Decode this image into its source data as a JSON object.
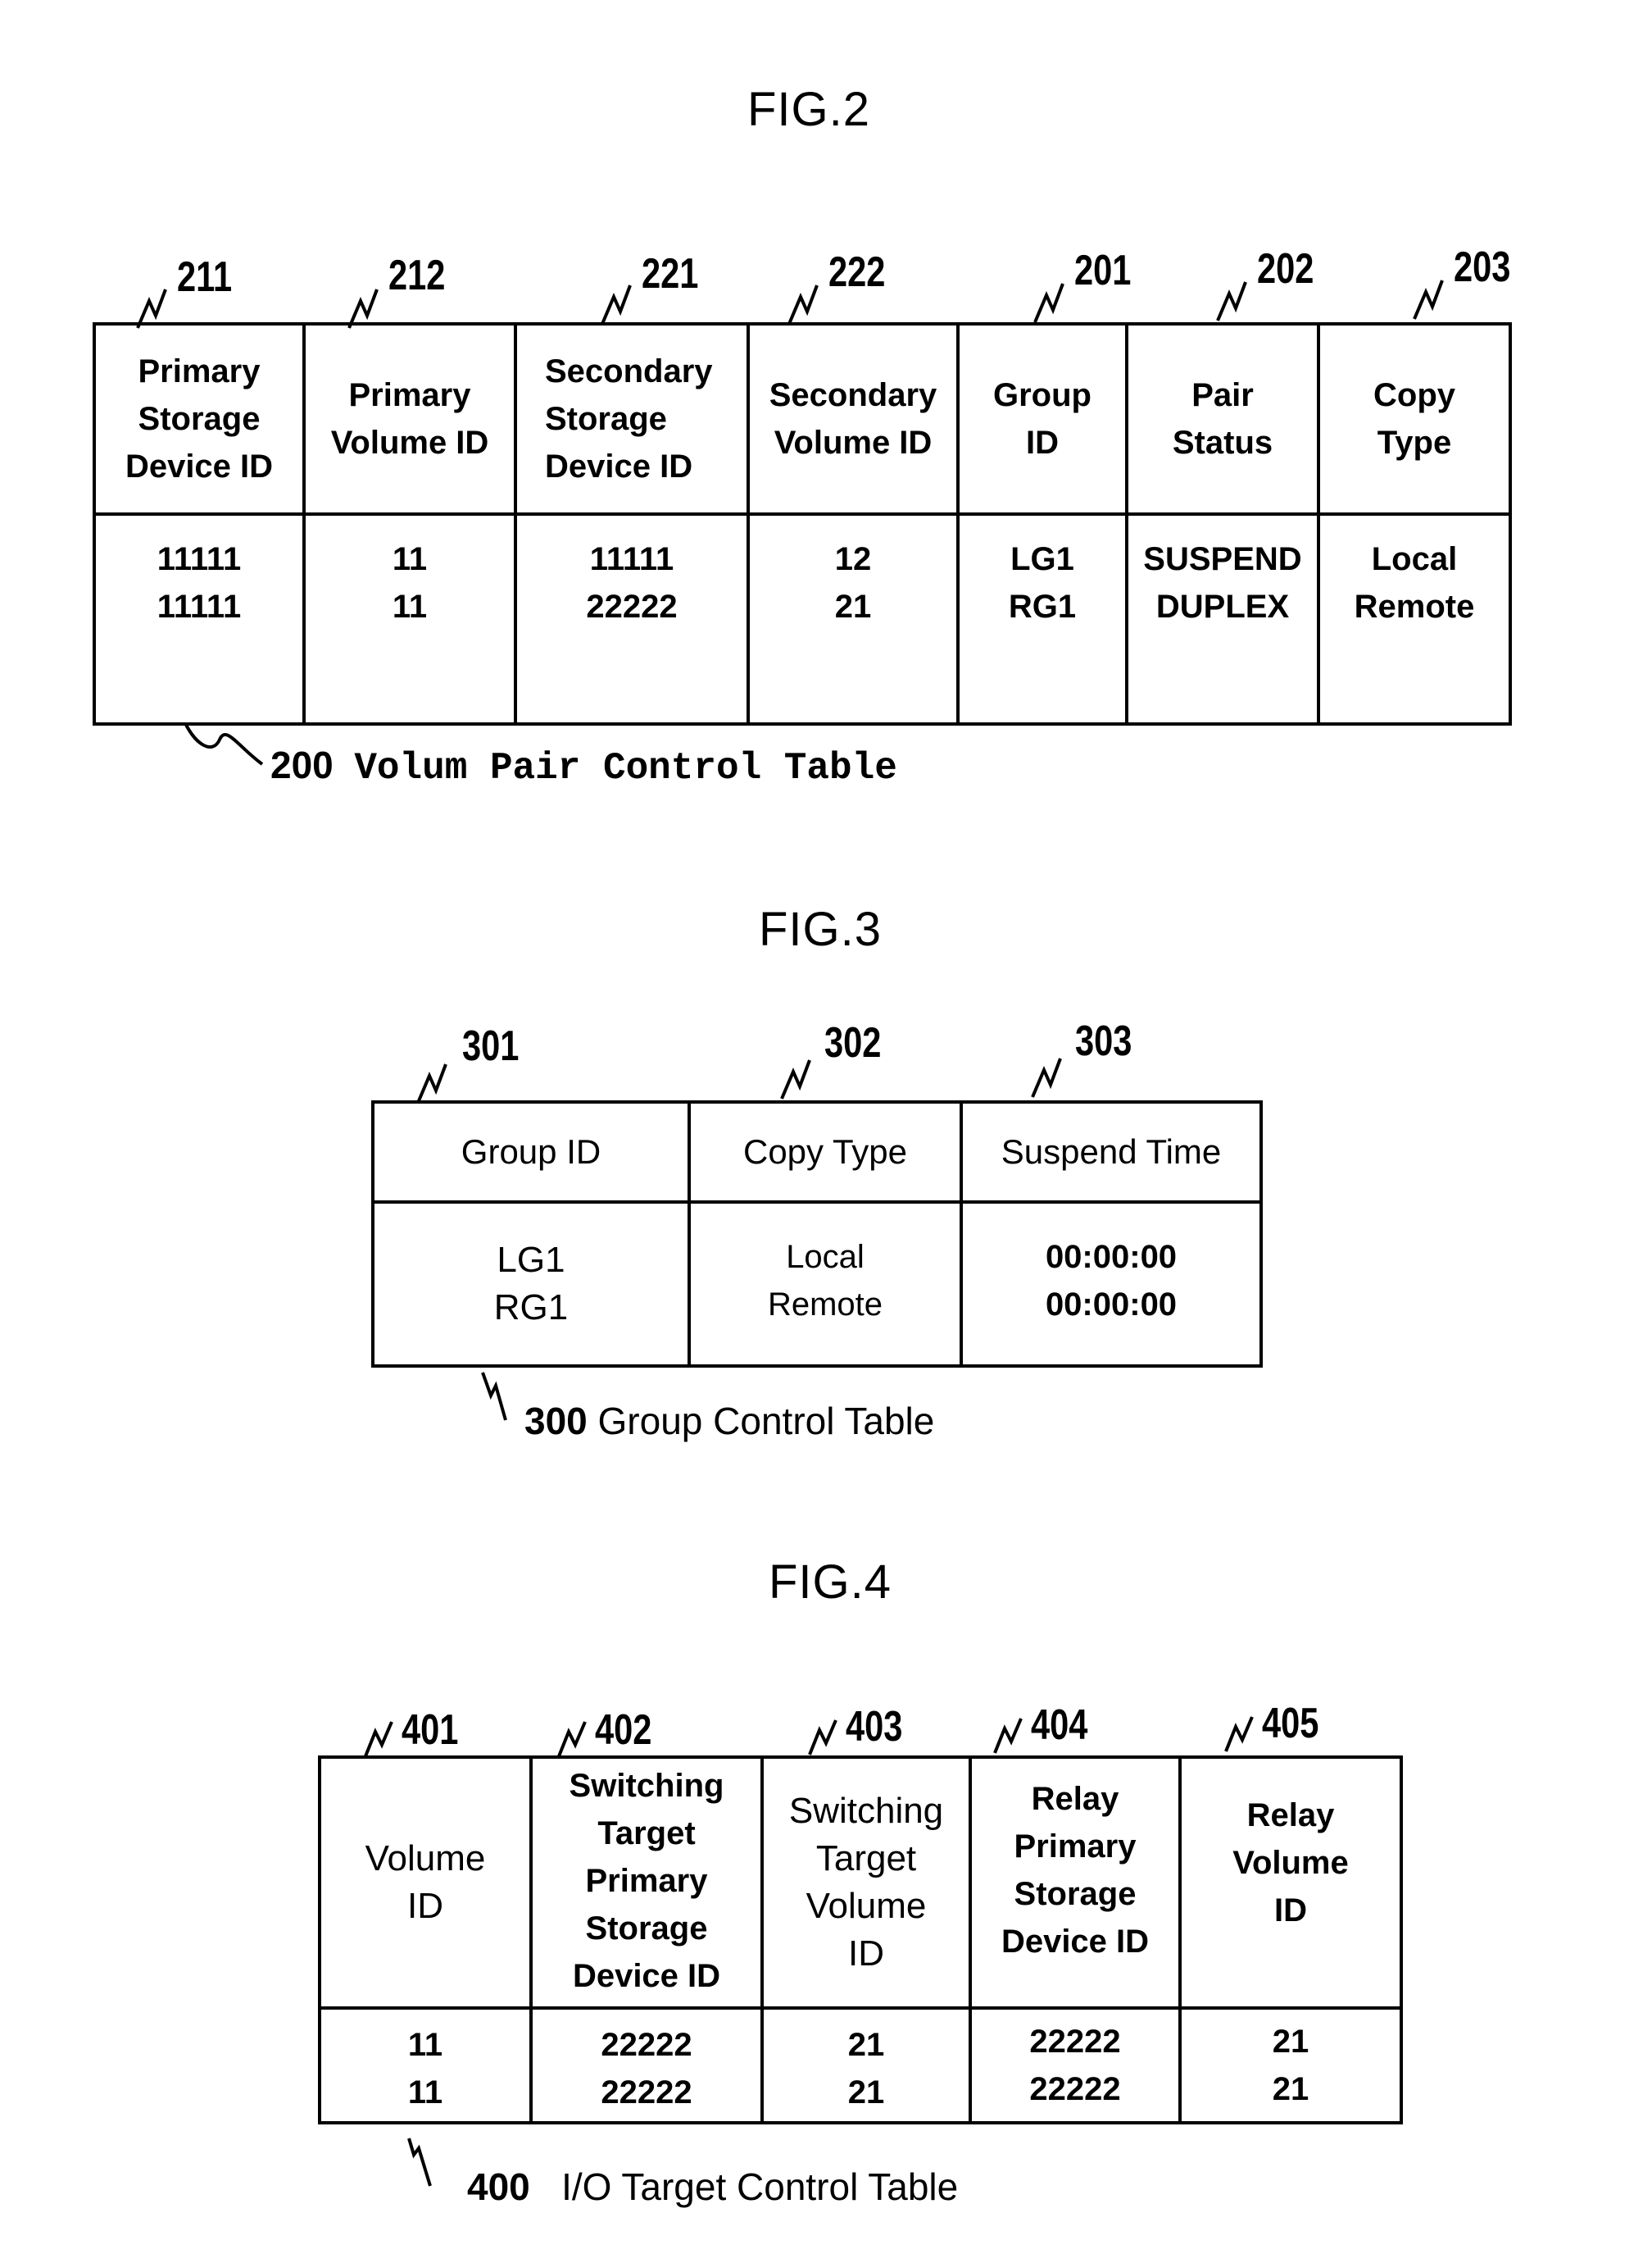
{
  "figures": [
    {
      "title": "FIG.2",
      "caption_number": "200",
      "caption_text": "Volum Pair Control Table",
      "columns": [
        {
          "ref": "211",
          "header": [
            "Primary",
            "Storage",
            "Device ID"
          ],
          "values": [
            "11111",
            "11111"
          ]
        },
        {
          "ref": "212",
          "header": [
            "Primary",
            "Volume ID"
          ],
          "values": [
            "11",
            "11"
          ]
        },
        {
          "ref": "221",
          "header": [
            "Secondary",
            "Storage",
            "Device ID"
          ],
          "values": [
            "11111",
            "22222"
          ]
        },
        {
          "ref": "222",
          "header": [
            "Secondary",
            "Volume ID"
          ],
          "values": [
            "12",
            "21"
          ]
        },
        {
          "ref": "201",
          "header": [
            "Group",
            "ID"
          ],
          "values": [
            "LG1",
            "RG1"
          ]
        },
        {
          "ref": "202",
          "header": [
            "Pair",
            "Status"
          ],
          "values": [
            "SUSPEND",
            "DUPLEX"
          ]
        },
        {
          "ref": "203",
          "header": [
            "Copy",
            "Type"
          ],
          "values": [
            "Local",
            "Remote"
          ]
        }
      ]
    },
    {
      "title": "FIG.3",
      "caption_number": "300",
      "caption_text": "Group Control Table",
      "columns": [
        {
          "ref": "301",
          "header": [
            "Group ID"
          ],
          "values": [
            "LG1",
            "RG1"
          ]
        },
        {
          "ref": "302",
          "header": [
            "Copy Type"
          ],
          "values": [
            "Local",
            "Remote"
          ]
        },
        {
          "ref": "303",
          "header": [
            "Suspend Time"
          ],
          "values": [
            "00:00:00",
            "00:00:00"
          ]
        }
      ]
    },
    {
      "title": "FIG.4",
      "caption_number": "400",
      "caption_text": "I/O Target Control Table",
      "columns": [
        {
          "ref": "401",
          "header": [
            "Volume",
            "ID"
          ],
          "values": [
            "11",
            "11"
          ]
        },
        {
          "ref": "402",
          "header": [
            "Switching",
            "Target",
            "Primary",
            "Storage",
            "Device ID"
          ],
          "values": [
            "22222",
            "22222"
          ]
        },
        {
          "ref": "403",
          "header": [
            "Switching",
            "Target",
            "Volume",
            "ID"
          ],
          "values": [
            "21",
            "21"
          ]
        },
        {
          "ref": "404",
          "header": [
            "Relay",
            "Primary",
            "Storage",
            "Device ID"
          ],
          "values": [
            "22222",
            "22222"
          ]
        },
        {
          "ref": "405",
          "header": [
            "Relay",
            "Volume",
            "ID"
          ],
          "values": [
            "21",
            "21"
          ]
        }
      ]
    }
  ]
}
